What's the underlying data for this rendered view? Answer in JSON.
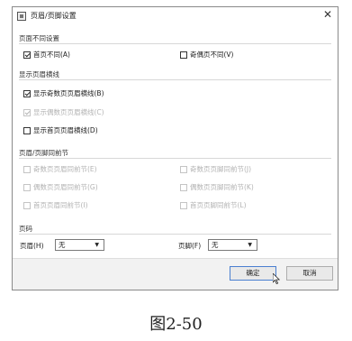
{
  "dialog": {
    "title": "页眉/页脚设置",
    "close_icon": "close-icon",
    "section_differs": {
      "header": "页面不同设置",
      "first_page": "首页不同(A)",
      "odd_even": "奇偶页不同(V)"
    },
    "section_lines": {
      "header": "显示页眉横线",
      "odd_header_line": "显示奇数页页眉横线(B)",
      "even_header_line": "显示偶数页页眉横线(C)",
      "first_header_line": "显示首页页眉横线(D)"
    },
    "section_sync": {
      "header": "页眉/页脚同前节",
      "odd_header_sync": "奇数页页眉同前节(E)",
      "odd_footer_sync": "奇数页页脚同前节(J)",
      "even_header_sync": "偶数页页眉同前节(G)",
      "even_footer_sync": "偶数页页脚同前节(K)",
      "first_header_sync": "首页页眉同前节(I)",
      "first_footer_sync": "首页页脚同前节(L)"
    },
    "section_pagenum": {
      "header": "页码",
      "header_label": "页眉(H)",
      "header_value": "无",
      "footer_label": "页脚(F)",
      "footer_value": "无"
    },
    "buttons": {
      "ok": "确定",
      "cancel": "取消"
    }
  },
  "caption": "图2-50"
}
